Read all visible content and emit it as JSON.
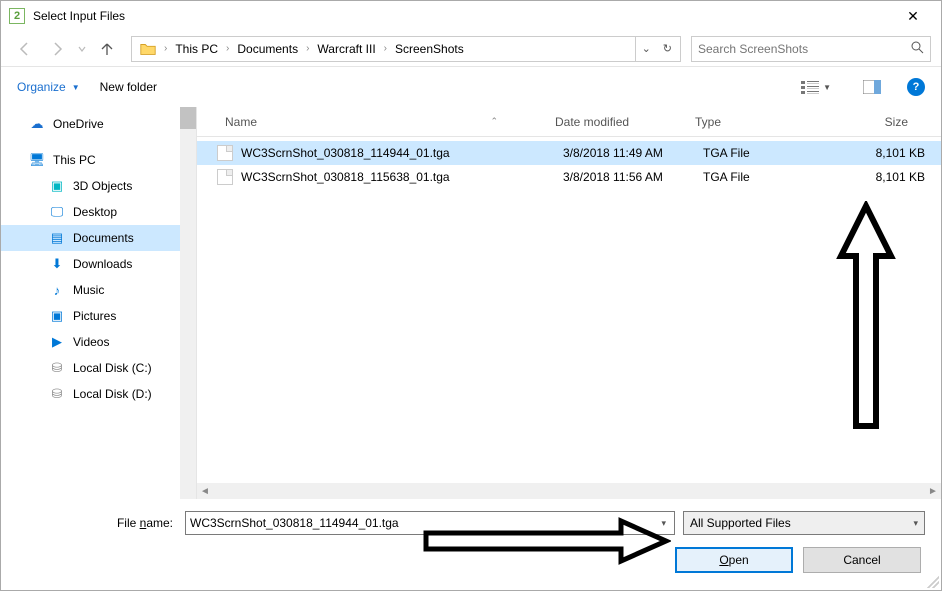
{
  "window": {
    "title": "Select Input Files"
  },
  "breadcrumb": {
    "items": [
      "This PC",
      "Documents",
      "Warcraft III",
      "ScreenShots"
    ]
  },
  "search": {
    "placeholder": "Search ScreenShots"
  },
  "toolbar": {
    "organize": "Organize",
    "new_folder": "New folder"
  },
  "sidebar": {
    "items": [
      {
        "label": "OneDrive"
      },
      {
        "label": "This PC"
      },
      {
        "label": "3D Objects"
      },
      {
        "label": "Desktop"
      },
      {
        "label": "Documents"
      },
      {
        "label": "Downloads"
      },
      {
        "label": "Music"
      },
      {
        "label": "Pictures"
      },
      {
        "label": "Videos"
      },
      {
        "label": "Local Disk (C:)"
      },
      {
        "label": "Local Disk (D:)"
      }
    ]
  },
  "columns": {
    "name": "Name",
    "date": "Date modified",
    "type": "Type",
    "size": "Size"
  },
  "files": [
    {
      "name": "WC3ScrnShot_030818_114944_01.tga",
      "date": "3/8/2018 11:49 AM",
      "type": "TGA File",
      "size": "8,101 KB"
    },
    {
      "name": "WC3ScrnShot_030818_115638_01.tga",
      "date": "3/8/2018 11:56 AM",
      "type": "TGA File",
      "size": "8,101 KB"
    }
  ],
  "bottom": {
    "filename_label_pre": "File ",
    "filename_label_u": "n",
    "filename_label_post": "ame:",
    "filename_value": "WC3ScrnShot_030818_114944_01.tga",
    "filter": "All Supported Files",
    "open_u": "O",
    "open_post": "pen",
    "cancel": "Cancel"
  }
}
